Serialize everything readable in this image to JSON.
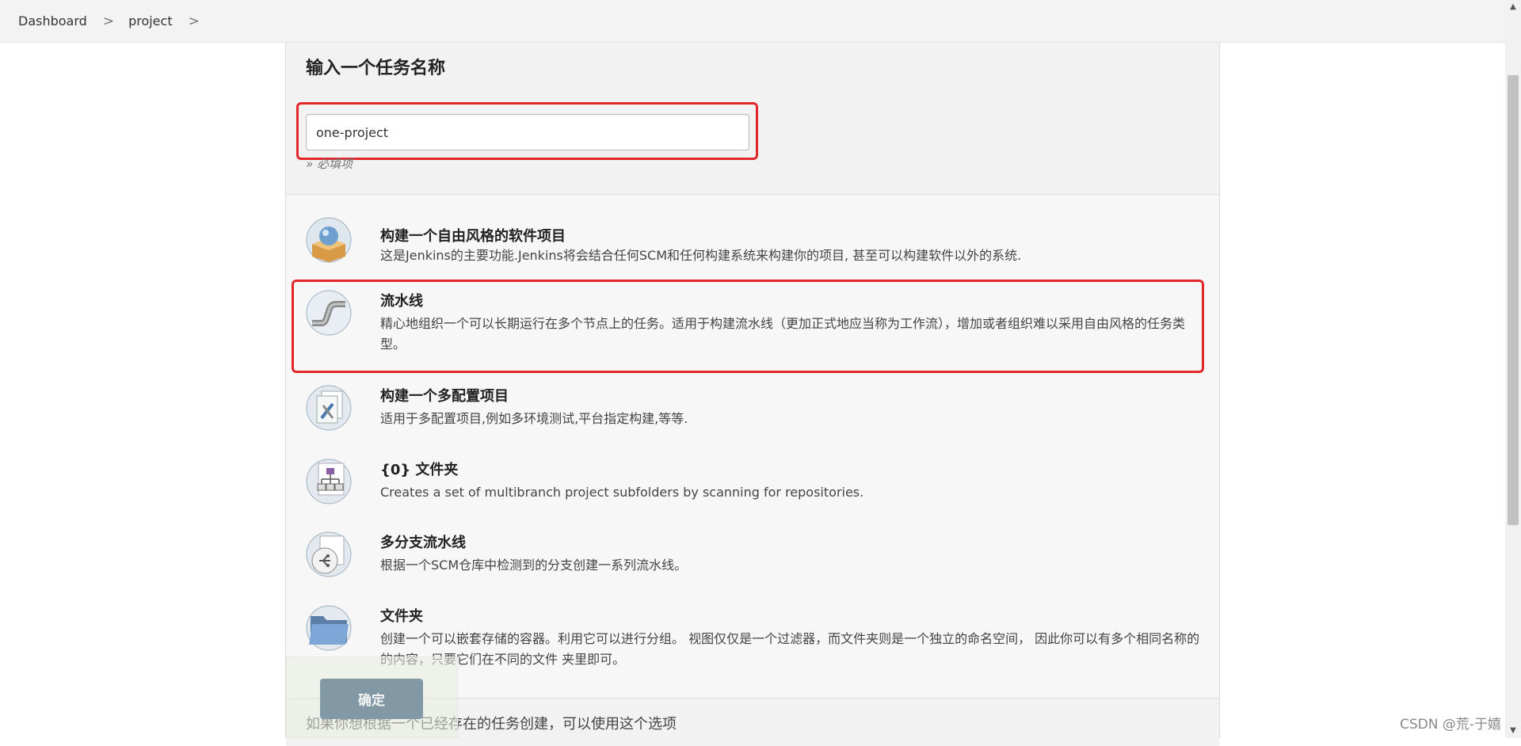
{
  "breadcrumb": {
    "items": [
      "Dashboard",
      "project"
    ],
    "separator": ">"
  },
  "name_section": {
    "heading": "输入一个任务名称",
    "input_value": "one-project",
    "required_hint": "» 必填项"
  },
  "items": [
    {
      "title": "构建一个自由风格的软件项目",
      "desc": "这是Jenkins的主要功能.Jenkins将会结合任何SCM和任何构建系统来构建你的项目, 甚至可以构建软件以外的系统.",
      "icon": "freestyle-project-icon"
    },
    {
      "title": "流水线",
      "desc": "精心地组织一个可以长期运行在多个节点上的任务。适用于构建流水线（更加正式地应当称为工作流），增加或者组织难以采用自由风格的任务类型。",
      "icon": "pipeline-icon"
    },
    {
      "title": "构建一个多配置项目",
      "desc": "适用于多配置项目,例如多环境测试,平台指定构建,等等.",
      "icon": "multi-config-icon"
    },
    {
      "title": "{0} 文件夹",
      "desc": "Creates a set of multibranch project subfolders by scanning for repositories.",
      "icon": "org-folder-icon"
    },
    {
      "title": "多分支流水线",
      "desc": "根据一个SCM仓库中检测到的分支创建一系列流水线。",
      "icon": "multibranch-pipeline-icon"
    },
    {
      "title": "文件夹",
      "desc": "创建一个可以嵌套存储的容器。利用它可以进行分组。 视图仅仅是一个过滤器，而文件夹则是一个独立的命名空间， 因此你可以有多个相同名称的的内容，只要它们在不同的文件 夹里即可。",
      "icon": "folder-icon"
    }
  ],
  "ok_button": "确定",
  "copy_section_text": "如果你想根据一个已经存在的任务创建，可以使用这个选项",
  "watermark": "CSDN @荒-于嬉",
  "colors": {
    "highlight": "#e3262a",
    "ok_button": "#8299a5",
    "panel_bg": "#f7f7f7"
  }
}
